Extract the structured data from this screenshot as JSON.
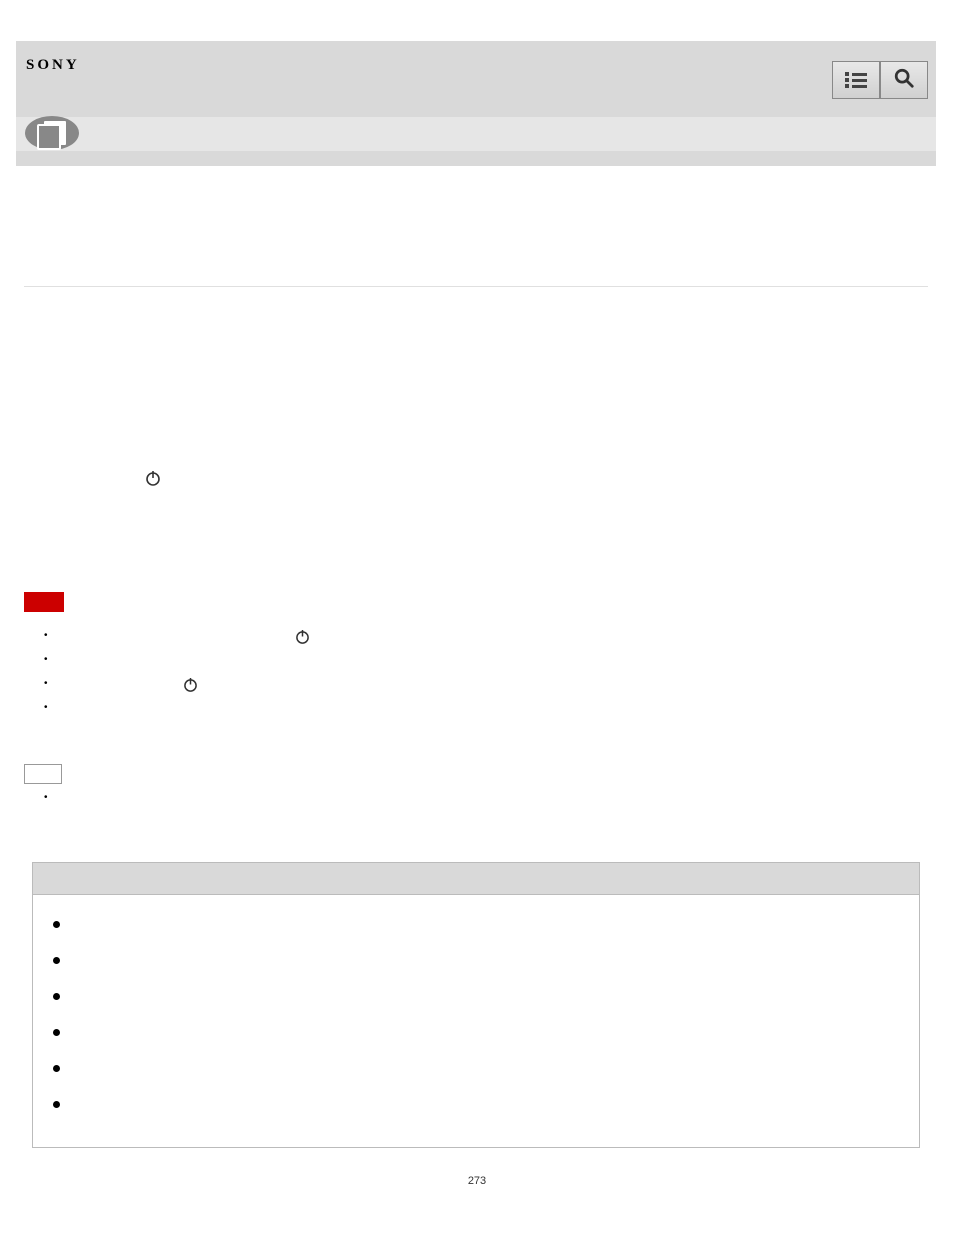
{
  "header": {
    "logo_text": "SONY",
    "menu_icon": "menu-icon",
    "search_icon": "search-icon"
  },
  "content": {
    "power_icon": "power-icon"
  },
  "page_number": "273"
}
